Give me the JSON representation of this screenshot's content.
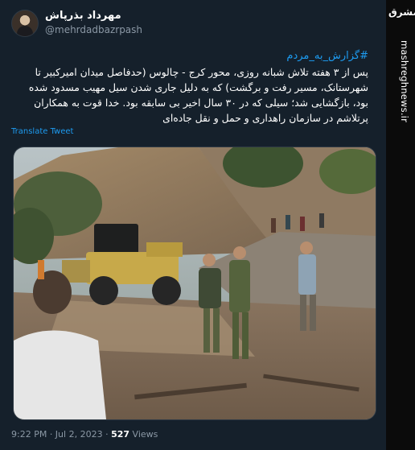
{
  "author": {
    "display_name": "مهرداد بذرپاش",
    "handle": "@mehrdadbazrpash"
  },
  "tweet": {
    "hashtag": "#گزارش_به_مردم",
    "body": "پس از ۳ هفته تلاش شبانه روزی، محور کرج - چالوس (حدفاصل میدان امیرکبیر تا شهرستانک، مسیر رفت و برگشت) که به دلیل جاری شدن سیل مهیب مسدود شده بود، بازگشایی شد؛ سیلی که در ۳۰ سال اخیر بی سابقه بود. خدا قوت به همکاران پرتلاشم در سازمان راهداری و حمل و نقل جاده‌ای",
    "translate_label": "Translate Tweet"
  },
  "meta": {
    "time": "9:22 PM · Jul 2, 2023 ·",
    "view_count": "527",
    "view_label": "Views"
  },
  "watermark": {
    "logo_text": "مشرق",
    "domain": "mashreghnews.ir"
  },
  "colors": {
    "background": "#15202b",
    "link": "#1d9bf0",
    "secondary": "#8b98a5"
  }
}
